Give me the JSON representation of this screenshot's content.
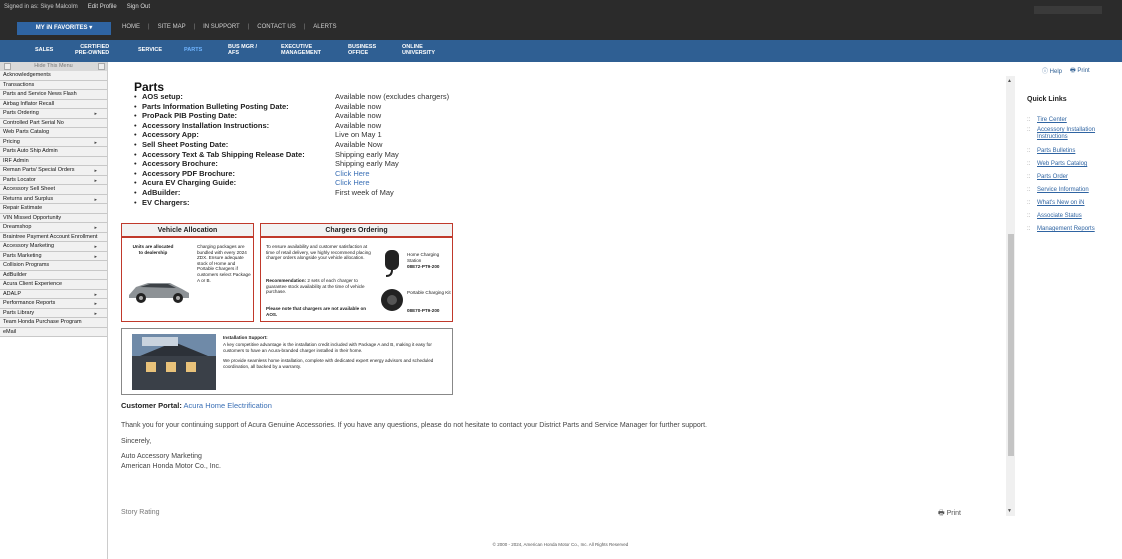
{
  "topbar": {
    "signed_in": "Signed in as: Skye Malcolm",
    "edit_profile": "Edit Profile",
    "sign_out": "Sign Out",
    "favorites": "MY iN FAVORITES  ▾",
    "nav": [
      "HOME",
      "SITE MAP",
      "IN SUPPORT",
      "CONTACT US",
      "ALERTS"
    ],
    "nav_sep": "|"
  },
  "tabs": {
    "sales": "SALES",
    "certified": "CERTIFIED\nPRE-OWNED",
    "service": "SERVICE",
    "parts": "PARTS",
    "bus_mgr": "BUS MGR /\nAFS",
    "exec": "EXECUTIVE\nMANAGEMENT",
    "business": "BUSINESS\nOFFICE",
    "online": "ONLINE\nUNIVERSITY"
  },
  "sidebar": {
    "hide": "Hide This Menu",
    "items": [
      {
        "label": "Acknowledgements",
        "arrow": ""
      },
      {
        "label": "Transactions",
        "arrow": ""
      },
      {
        "label": "Parts and Service News Flash",
        "arrow": ""
      },
      {
        "label": "Airbag Inflator Recall",
        "arrow": ""
      },
      {
        "label": "Parts Ordering",
        "arrow": "▸"
      },
      {
        "label": "Controlled Part Serial No",
        "arrow": ""
      },
      {
        "label": "Web Parts Catalog",
        "arrow": ""
      },
      {
        "label": "Pricing",
        "arrow": "▸"
      },
      {
        "label": "Parts Auto Ship Admin",
        "arrow": ""
      },
      {
        "label": "IRF Admin",
        "arrow": ""
      },
      {
        "label": "Reman Parts/ Special Orders",
        "arrow": "▸"
      },
      {
        "label": "Parts Locator",
        "arrow": "▸"
      },
      {
        "label": "Accessory Sell Sheet",
        "arrow": ""
      },
      {
        "label": "Returns and Surplus",
        "arrow": "▸"
      },
      {
        "label": "Repair Estimate",
        "arrow": ""
      },
      {
        "label": "VIN Missed Opportunity",
        "arrow": ""
      },
      {
        "label": "Dreamshop",
        "arrow": "▸"
      },
      {
        "label": "Braintree Payment Account Enrollment",
        "arrow": ""
      },
      {
        "label": "Accessory Marketing",
        "arrow": "▸"
      },
      {
        "label": "Parts Marketing",
        "arrow": "▸"
      },
      {
        "label": "Collision Programs",
        "arrow": ""
      },
      {
        "label": "AdBuilder",
        "arrow": ""
      },
      {
        "label": "Acura Client Experience",
        "arrow": ""
      },
      {
        "label": "ADALP",
        "arrow": "▸"
      },
      {
        "label": "Performance Reports",
        "arrow": "▸"
      },
      {
        "label": "Parts Library",
        "arrow": "▸"
      },
      {
        "label": "Team Honda Purchase Program",
        "arrow": ""
      },
      {
        "label": "eMail",
        "arrow": ""
      }
    ]
  },
  "main": {
    "title": "Parts",
    "rows": [
      {
        "label": "AOS setup:",
        "value": "Available now (excludes chargers)"
      },
      {
        "label": "Parts Information Bulleting Posting Date:",
        "value": "Available now"
      },
      {
        "label": "ProPack PIB Posting Date:",
        "value": "Available now"
      },
      {
        "label": "Accessory Installation Instructions:",
        "value": "Available now"
      },
      {
        "label": "Accessory App:",
        "value": "Live on May 1"
      },
      {
        "label": "Sell Sheet Posting Date:",
        "value": "Available Now"
      },
      {
        "label": "Accessory Text & Tab Shipping Release Date:",
        "value": "Shipping early May"
      },
      {
        "label": "Accessory Brochure:",
        "value": "Shipping early May"
      },
      {
        "label": "Accessory PDF Brochure:",
        "value": "Click Here"
      },
      {
        "label": "Acura EV Charging Guide:",
        "value": "Click Here"
      },
      {
        "label": "AdBuilder:",
        "value": "First week of May"
      },
      {
        "label": "EV Chargers:",
        "value": ""
      }
    ],
    "vehicle_allocation": {
      "title": "Vehicle Allocation",
      "allocated": "Units are allocated to dealership",
      "packages": "Charging packages are bundled with every 2024 ZDX. Ensure adequate stock of Home and Portable Chargers if customers select Package A or B."
    },
    "chargers": {
      "title": "Chargers Ordering",
      "text1": "To ensure availability and customer satisfaction at time of retail delivery, we highly recommend placing charger orders alongside your vehicle allocation.",
      "rec_label": "Recommendation:",
      "rec_text": "2 sets of each charger to guarantee stock availability at the time of vehicle purchase.",
      "note": "Please note that chargers are not available on AOS.",
      "home_label": "Home Charging Station",
      "home_pn": "08E72-PT9-200",
      "portable_label": "Portable Charging Kit",
      "portable_pn": "08E70-PT9-200"
    },
    "installation": {
      "title": "Installation Support:",
      "text1": "A key competitive advantage is the installation credit included with Package A and B, making it easy for customers to have an Acura-branded charger installed in their home.",
      "text2": "We provide seamless home installation, complete with dedicated expert energy advisors and scheduled coordination, all backed by a warranty."
    },
    "portal_label": "Customer Portal:",
    "portal_link": "Acura Home Electrification",
    "thanks": "Thank you for your continuing support of Acura Genuine Accessories. If you have any questions, please do not hesitate to contact your District Parts and Service Manager for further support.",
    "sincerely": "Sincerely,",
    "sig1": "Auto Accessory Marketing",
    "sig2": "American Honda Motor Co., Inc.",
    "rating": "Story Rating",
    "print_bottom": "Print",
    "footer": "© 2000 - 2024, American Honda Motor Co., Inc. All Rights Reserved"
  },
  "right": {
    "help": "Help",
    "print": "Print",
    "quick_links_title": "Quick Links",
    "links": [
      "Tire Center",
      "Accessory Installation Instructions",
      "Parts Bulletins",
      "Web Parts Catalog",
      "Parts Order",
      "Service Information",
      "What's New on iN",
      "Associate Status",
      "Management Reports"
    ]
  },
  "colors": {
    "tabbar": "#2f5f93",
    "accent": "#3a6fb5",
    "box_border": "#c0392b"
  }
}
